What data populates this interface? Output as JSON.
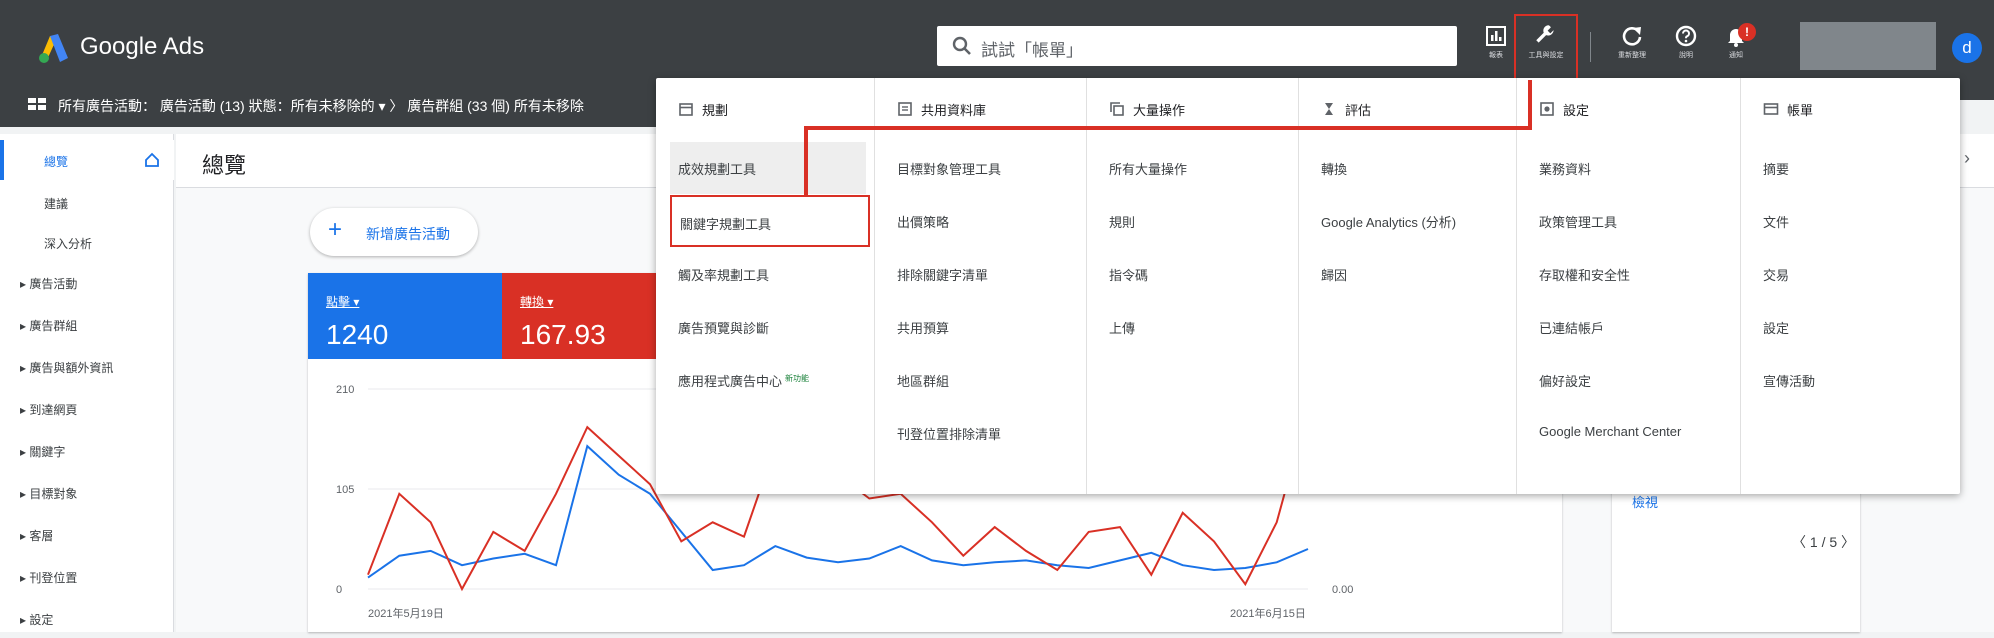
{
  "app": {
    "title": "Google Ads"
  },
  "search": {
    "placeholder": "試試「帳單」"
  },
  "toolbar": {
    "reports_label": "報表",
    "tools_label": "工具與設定",
    "refresh_label": "重新整理",
    "help_label": "說明",
    "notifications_label": "通知",
    "notification_badge": "!",
    "avatar_initial": "d"
  },
  "filter_bar": {
    "text": "所有廣告活動： 廣告活動 (13) 狀態：所有未移除的 ▾  〉 廣告群組 (33 個)  所有未移除"
  },
  "sidebar": {
    "items": [
      {
        "label": "總覽"
      },
      {
        "label": "建議"
      },
      {
        "label": "深入分析"
      },
      {
        "label": "▸ 廣告活動"
      },
      {
        "label": "▸ 廣告群組"
      },
      {
        "label": "▸ 廣告與額外資訊"
      },
      {
        "label": "▸ 到達網頁"
      },
      {
        "label": "▸ 關鍵字"
      },
      {
        "label": "▸ 目標對象"
      },
      {
        "label": "▸ 客層"
      },
      {
        "label": "▸ 刊登位置"
      },
      {
        "label": "▸ 設定"
      }
    ]
  },
  "main": {
    "page_title": "總覽",
    "new_campaign_label": "新增廣告活動",
    "metrics": [
      {
        "label": "點擊 ▾",
        "value": "1240",
        "color": "#1a73e8"
      },
      {
        "label": "轉換 ▾",
        "value": "167.93",
        "color": "#d93025"
      }
    ],
    "right_card": {
      "view_label": "檢視",
      "pager": "〈 1 / 5 〉"
    }
  },
  "chart_data": {
    "type": "line",
    "title": "",
    "xlabel": "",
    "ylabel": "",
    "y_ticks_left": [
      "210",
      "105",
      "0"
    ],
    "y_ticks_right": [
      "0.00"
    ],
    "x_labels": [
      "2021年5月19日",
      "2021年6月15日"
    ],
    "ylim": [
      0,
      210
    ],
    "series": [
      {
        "color": "#1a73e8",
        "values": [
          12,
          35,
          40,
          25,
          32,
          37,
          25,
          150,
          120,
          100,
          60,
          20,
          25,
          45,
          33,
          28,
          32,
          45,
          30,
          25,
          28,
          30,
          25,
          22,
          30,
          38,
          25,
          20,
          22,
          28,
          42
        ]
      },
      {
        "color": "#d93025",
        "values": [
          15,
          100,
          70,
          0,
          60,
          40,
          100,
          170,
          140,
          110,
          50,
          70,
          55,
          150,
          130,
          120,
          95,
          100,
          70,
          35,
          65,
          40,
          20,
          60,
          65,
          15,
          80,
          50,
          5,
          70,
          190
        ]
      }
    ]
  },
  "tools_menu": {
    "columns": [
      {
        "header": "規劃",
        "icon": "calendar-icon",
        "items": [
          "成效規劃工具",
          "關鍵字規劃工具",
          "觸及率規劃工具",
          "廣告預覽與診斷",
          "應用程式廣告中心"
        ],
        "new_badge": "新功能"
      },
      {
        "header": "共用資料庫",
        "icon": "library-icon",
        "items": [
          "目標對象管理工具",
          "出價策略",
          "排除關鍵字清單",
          "共用預算",
          "地區群組",
          "刊登位置排除清單"
        ]
      },
      {
        "header": "大量操作",
        "icon": "copy-icon",
        "items": [
          "所有大量操作",
          "規則",
          "指令碼",
          "上傳"
        ]
      },
      {
        "header": "評估",
        "icon": "hourglass-icon",
        "items": [
          "轉換",
          "Google Analytics (分析)",
          "歸因"
        ]
      },
      {
        "header": "設定",
        "icon": "settings-icon",
        "items": [
          "業務資料",
          "政策管理工具",
          "存取權和安全性",
          "已連結帳戶",
          "偏好設定",
          "Google Merchant Center"
        ]
      },
      {
        "header": "帳單",
        "icon": "card-icon",
        "items": [
          "摘要",
          "文件",
          "交易",
          "設定",
          "宣傳活動"
        ]
      }
    ]
  }
}
